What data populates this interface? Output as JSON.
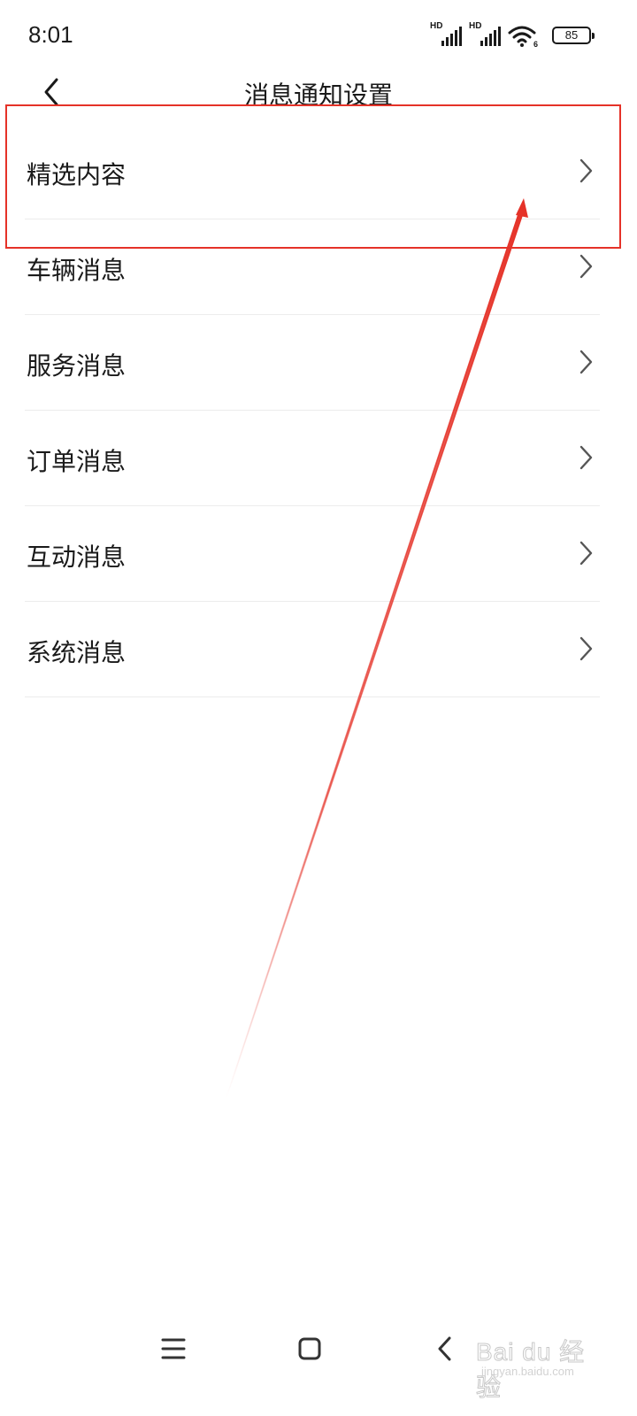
{
  "status_bar": {
    "time": "8:01",
    "signal_1_label": "HD",
    "signal_2_label": "HD",
    "wifi_label": "6",
    "battery_level": "85"
  },
  "header": {
    "title": "消息通知设置",
    "back_icon": "chevron-left-icon"
  },
  "settings": {
    "items": [
      {
        "label": "精选内容"
      },
      {
        "label": "车辆消息"
      },
      {
        "label": "服务消息"
      },
      {
        "label": "订单消息"
      },
      {
        "label": "互动消息"
      },
      {
        "label": "系统消息"
      }
    ]
  },
  "annotation": {
    "color": "#e53228",
    "highlighted_item": "精选内容"
  },
  "nav_bar": {
    "icons": [
      "menu-icon",
      "home-icon",
      "back-icon"
    ]
  },
  "watermark": {
    "main": "Bai du 经验",
    "sub": "jingyan.baidu.com"
  }
}
